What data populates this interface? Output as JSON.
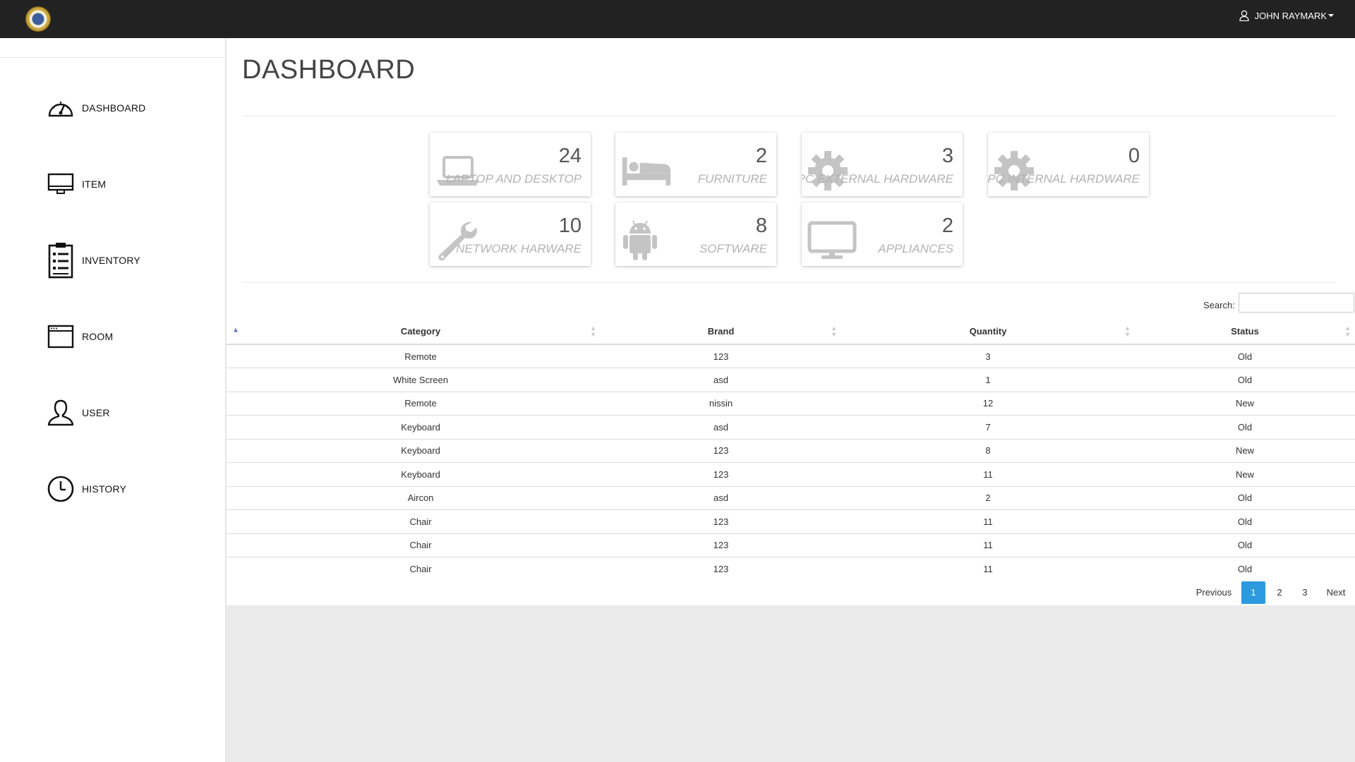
{
  "header": {
    "user_name": "JOHN RAYMARK"
  },
  "sidebar": {
    "items": [
      {
        "label": "DASHBOARD",
        "icon": "speedometer-icon"
      },
      {
        "label": "ITEM",
        "icon": "monitor-icon"
      },
      {
        "label": "INVENTORY",
        "icon": "clipboard-list-icon"
      },
      {
        "label": "ROOM",
        "icon": "window-icon"
      },
      {
        "label": "USER",
        "icon": "user-icon"
      },
      {
        "label": "HISTORY",
        "icon": "clock-icon"
      }
    ]
  },
  "main": {
    "title": "DASHBOARD",
    "cards": [
      {
        "count": "24",
        "label": "LAPTOP AND DESKTOP",
        "icon": "laptop-icon"
      },
      {
        "count": "2",
        "label": "FURNITURE",
        "icon": "bed-icon"
      },
      {
        "count": "3",
        "label": "PC EXTERNAL HARDWARE",
        "icon": "gear-icon"
      },
      {
        "count": "0",
        "label": "PC INTERNAL HARDWARE",
        "icon": "gear-icon"
      },
      {
        "count": "10",
        "label": "NETWORK HARWARE",
        "icon": "wrench-icon"
      },
      {
        "count": "8",
        "label": "SOFTWARE",
        "icon": "android-icon"
      },
      {
        "count": "2",
        "label": "APPLIANCES",
        "icon": "monitor-icon"
      }
    ],
    "search_label": "Search:",
    "search_value": "",
    "table": {
      "sort_indicator": "▲",
      "columns": [
        "Category",
        "Brand",
        "Quantity",
        "Status"
      ],
      "rows": [
        [
          "Remote",
          "123",
          "3",
          "Old"
        ],
        [
          "White Screen",
          "asd",
          "1",
          "Old"
        ],
        [
          "Remote",
          "nissin",
          "12",
          "New"
        ],
        [
          "Keyboard",
          "asd",
          "7",
          "Old"
        ],
        [
          "Keyboard",
          "123",
          "8",
          "New"
        ],
        [
          "Keyboard",
          "123",
          "11",
          "New"
        ],
        [
          "Aircon",
          "asd",
          "2",
          "Old"
        ],
        [
          "Chair",
          "123",
          "11",
          "Old"
        ],
        [
          "Chair",
          "123",
          "11",
          "Old"
        ],
        [
          "Chair",
          "123",
          "11",
          "Old"
        ]
      ]
    },
    "pagination": {
      "previous": "Previous",
      "pages": [
        "1",
        "2",
        "3"
      ],
      "active_page": "1",
      "next": "Next"
    }
  },
  "colors": {
    "topbar": "#222222",
    "active_page": "#2d9ae0",
    "card_label": "#b3b3b3"
  }
}
